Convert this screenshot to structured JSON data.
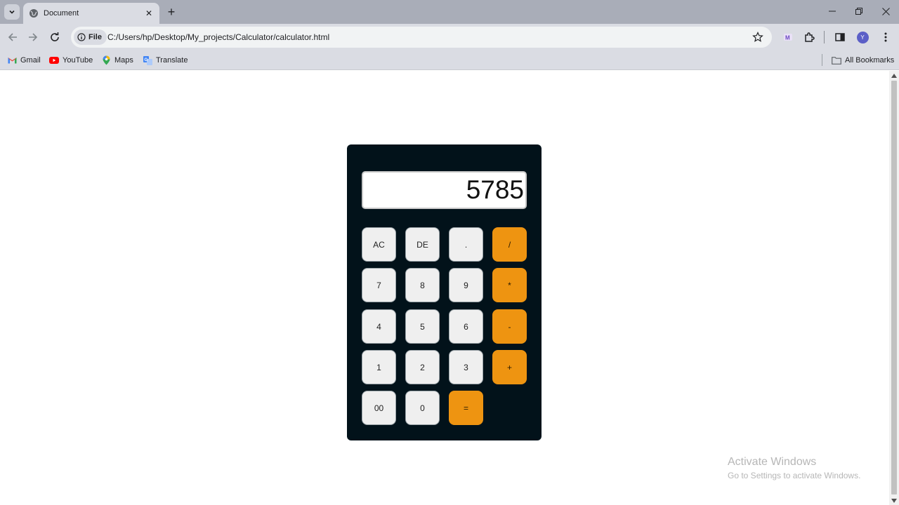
{
  "browser": {
    "tab": {
      "title": "Document"
    },
    "address": {
      "chip_label": "File",
      "url": "C:/Users/hp/Desktop/My_projects/Calculator/calculator.html"
    },
    "profile_initial": "Y",
    "bookmarks": [
      {
        "label": "Gmail",
        "icon": "gmail-icon"
      },
      {
        "label": "YouTube",
        "icon": "youtube-icon"
      },
      {
        "label": "Maps",
        "icon": "maps-icon"
      },
      {
        "label": "Translate",
        "icon": "translate-icon"
      }
    ],
    "all_bookmarks_label": "All Bookmarks"
  },
  "calculator": {
    "display_value": "5785",
    "keys": {
      "ac": "AC",
      "de": "DE",
      "dot": ".",
      "divide": "/",
      "seven": "7",
      "eight": "8",
      "nine": "9",
      "multiply": "*",
      "four": "4",
      "five": "5",
      "six": "6",
      "minus": "-",
      "one": "1",
      "two": "2",
      "three": "3",
      "plus": "+",
      "double_zero": "00",
      "zero": "0",
      "equals": "="
    },
    "colors": {
      "body": "#02121a",
      "operator": "#ee9411",
      "key": "#efefef"
    }
  },
  "watermark": {
    "title": "Activate Windows",
    "subtitle": "Go to Settings to activate Windows."
  }
}
